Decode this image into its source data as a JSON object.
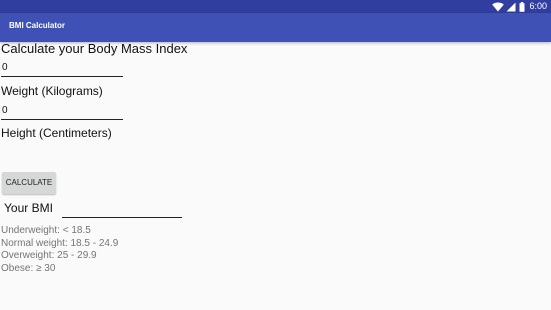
{
  "status_bar": {
    "time": "6:00",
    "icons": [
      "wifi-icon",
      "signal-icon",
      "battery-icon"
    ]
  },
  "app_bar": {
    "title": "BMI Calculator"
  },
  "form": {
    "heading": "Calculate your Body Mass Index",
    "weight_value": "0",
    "weight_label": "Weight (Kilograms)",
    "height_value": "0",
    "height_label": "Height (Centimeters)",
    "calculate_label": "CALCULATE",
    "bmi_label": "Your BMI",
    "bmi_value": ""
  },
  "categories": [
    "Underweight: < 18.5",
    "Normal weight: 18.5 - 24.9",
    "Overweight: 25 - 29.9",
    "Obese: ≥ 30"
  ],
  "colors": {
    "status_bar": "#303f9f",
    "app_bar": "#3f51b5",
    "button": "#d6d7d7",
    "category_text": "#757575"
  }
}
